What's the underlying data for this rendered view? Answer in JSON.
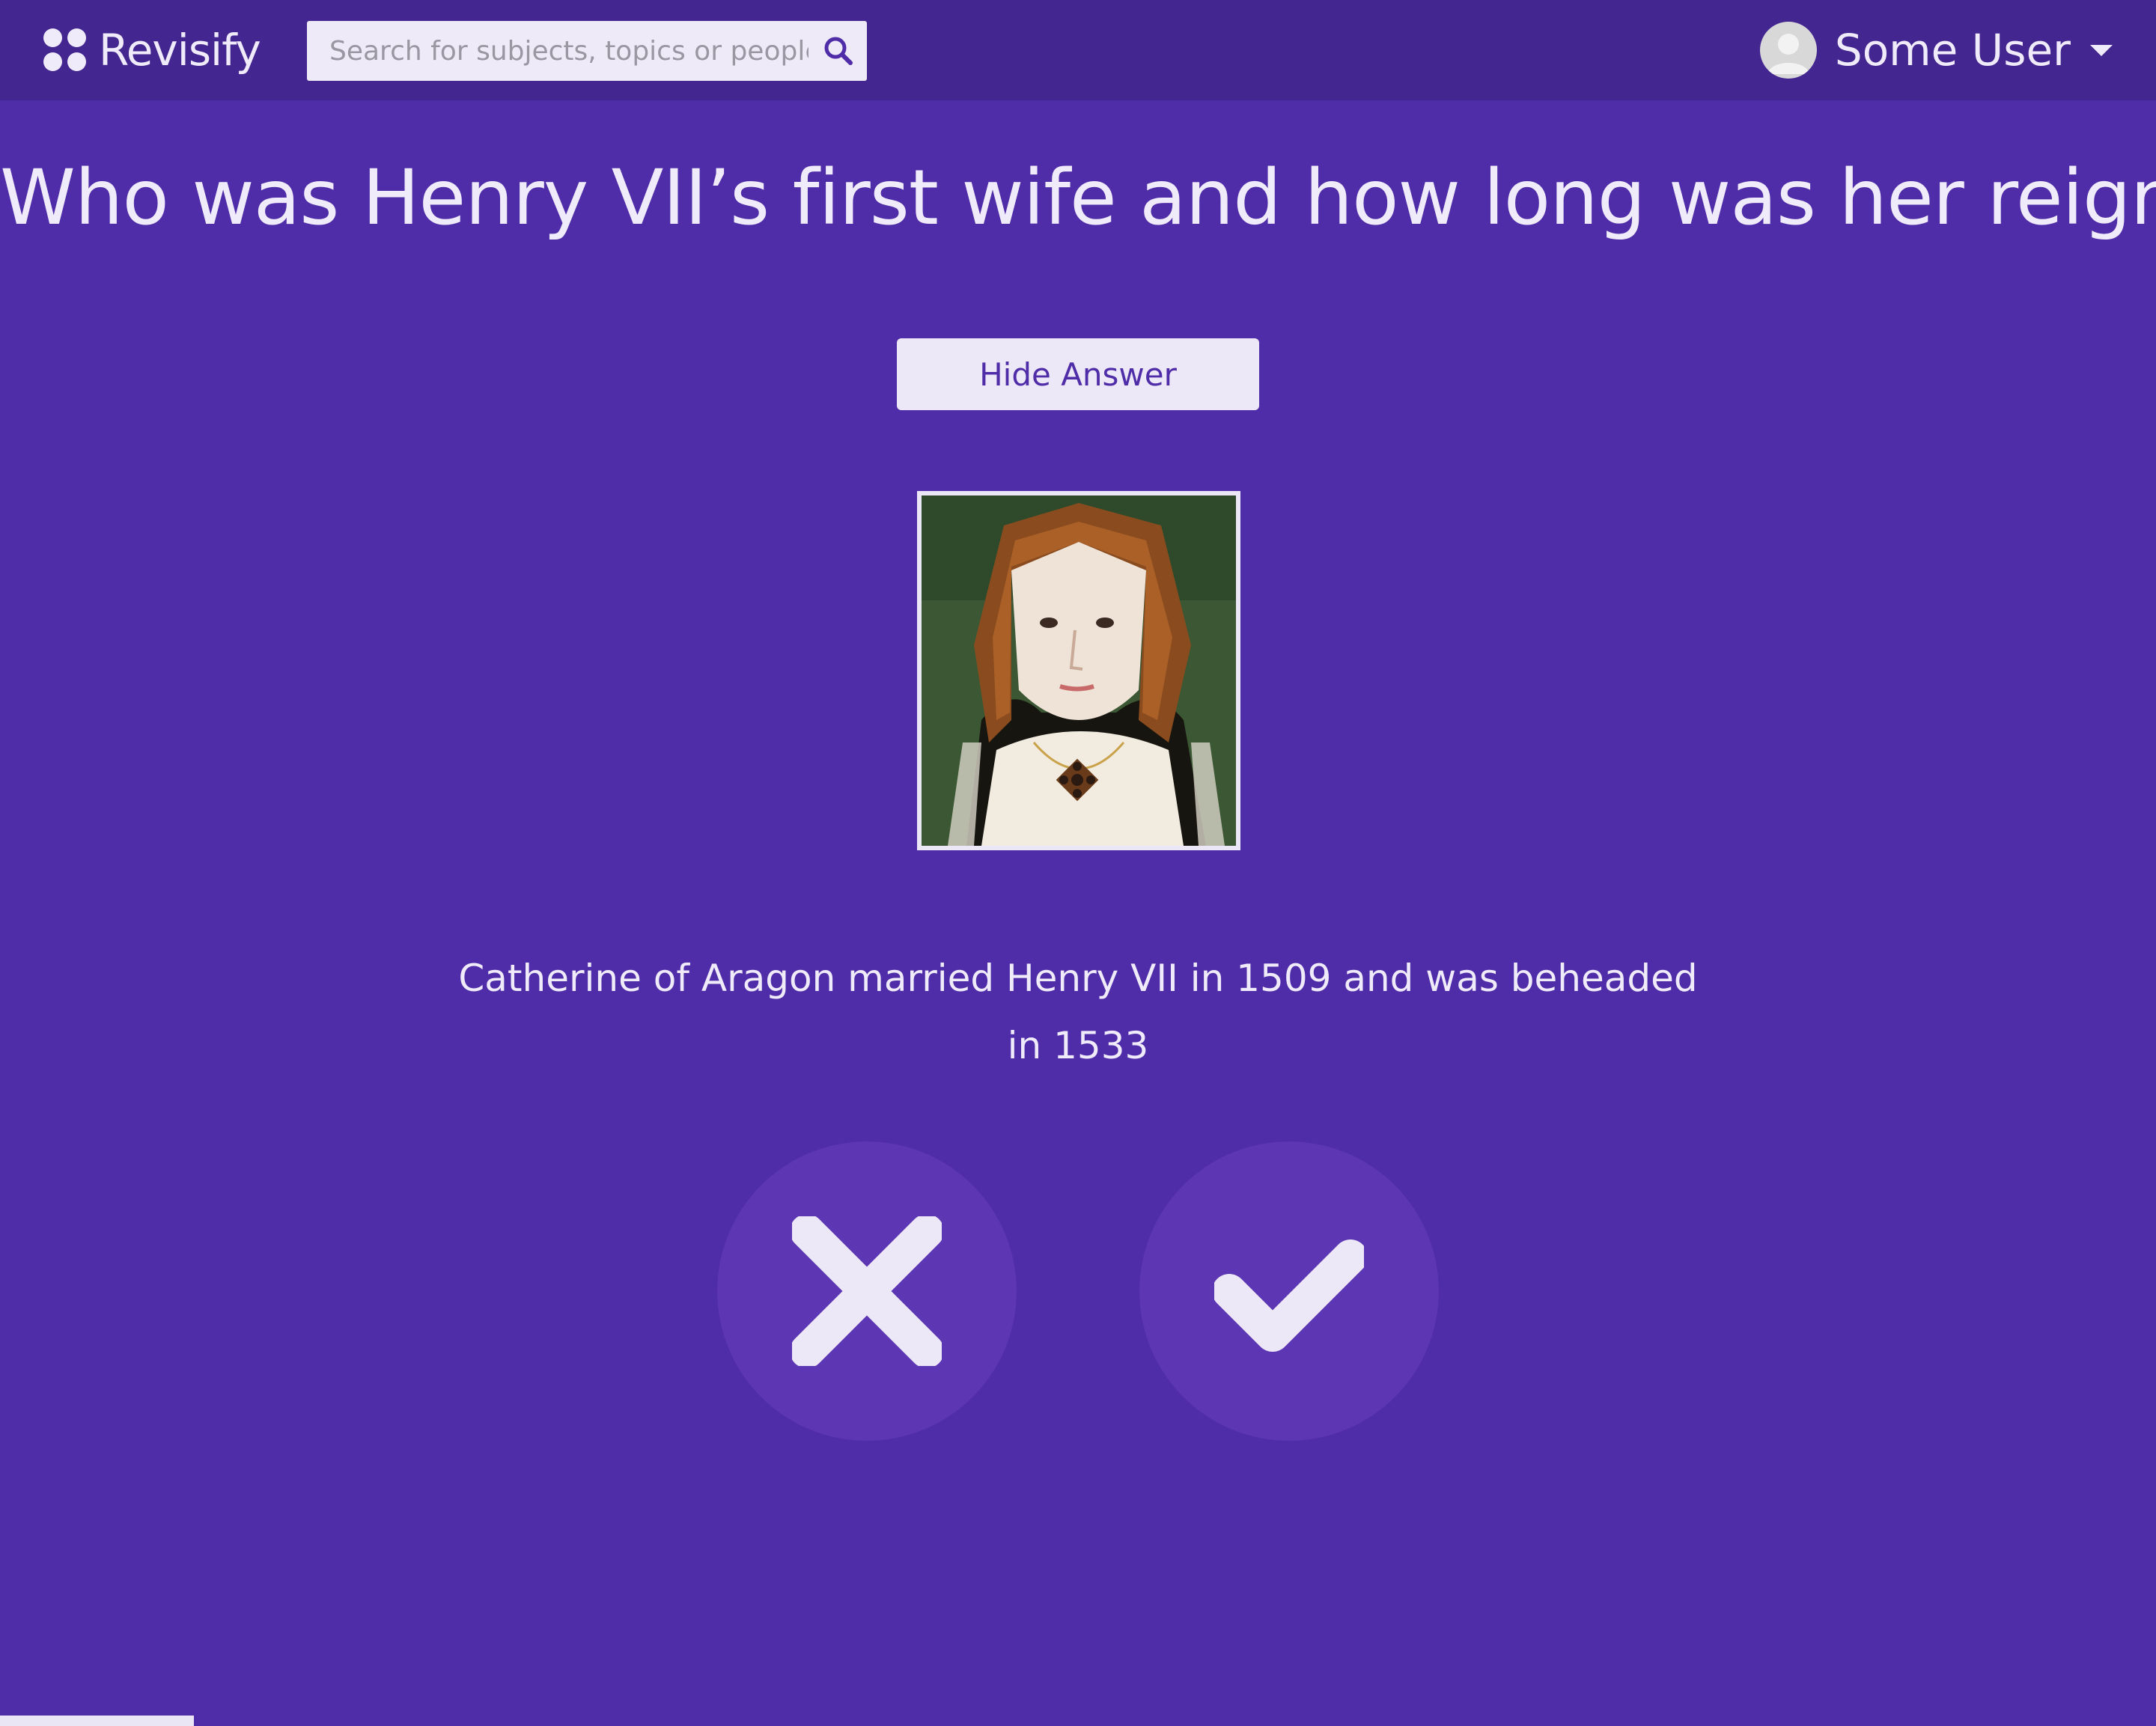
{
  "app": {
    "name": "Revisify"
  },
  "search": {
    "placeholder": "Search for subjects, topics or people"
  },
  "user": {
    "name": "Some User"
  },
  "card": {
    "question": "Who was Henry VII’s first wife and how long was her reign?",
    "toggle_label": "Hide Answer",
    "image_alt": "Portrait of Catherine of Aragon",
    "answer": "Catherine of Aragon married Henry VII in 1509 and was beheaded in 1533"
  },
  "actions": {
    "wrong_icon": "close-icon",
    "right_icon": "checkmark-icon"
  },
  "progress": {
    "fraction": 0.09
  },
  "colors": {
    "background": "#4f2ca8",
    "navbar": "#43268f",
    "circle": "#5c36b3",
    "foreground": "#f0ebfa"
  }
}
